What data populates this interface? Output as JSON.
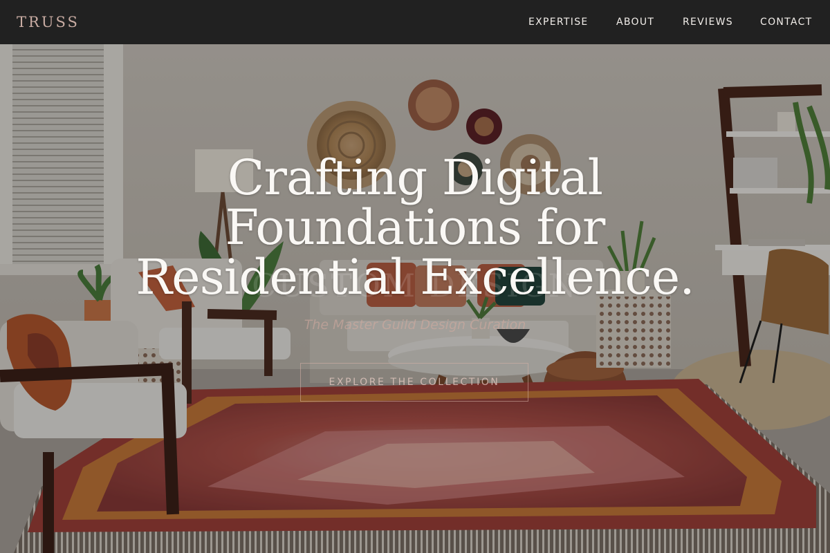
{
  "brand": {
    "logo": "TRUSS"
  },
  "nav": {
    "links": [
      {
        "label": "EXPERTISE"
      },
      {
        "label": "ABOUT"
      },
      {
        "label": "REVIEWS"
      },
      {
        "label": "CONTACT"
      }
    ]
  },
  "hero": {
    "title_lines": [
      "Crafting Digital",
      "Foundations for",
      "Residential Excellence."
    ],
    "watermark": "CUSTOM DESIGN",
    "tagline": "The Master Guild Design Curation",
    "cta_label": "EXPLORE THE COLLECTION"
  },
  "colors": {
    "nav_background": "#212121",
    "logo": "#c9aca3",
    "nav_text": "#f2eeea",
    "hero_title": "#faf8f5",
    "accent_rose": "#d7b2a8"
  }
}
